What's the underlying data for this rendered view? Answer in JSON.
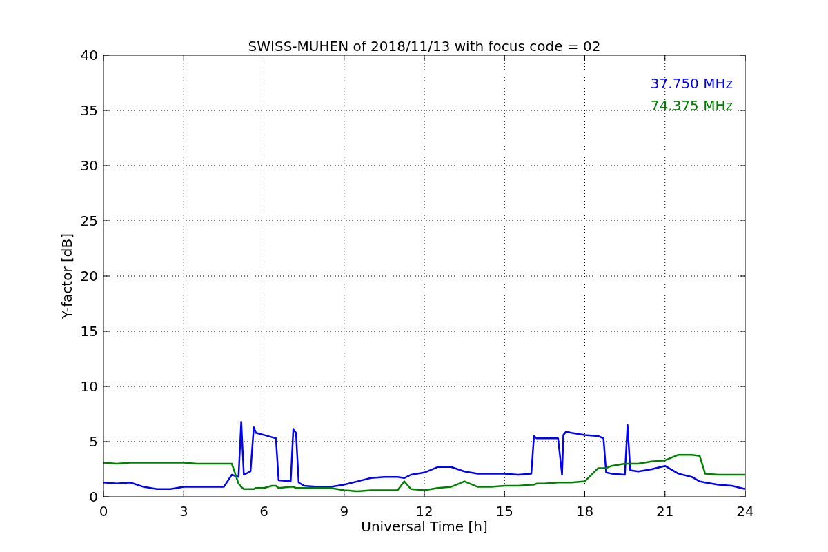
{
  "figure": {
    "chart_data": {
      "type": "line",
      "title": "SWISS-MUHEN of 2018/11/13 with focus code = 02",
      "xlabel": "Universal Time [h]",
      "ylabel": "Y-factor [dB]",
      "x": [
        0,
        0.5,
        1,
        1.5,
        2,
        2.5,
        3,
        3.5,
        4,
        4.5,
        4.8,
        5.05,
        5.15,
        5.25,
        5.5,
        5.62,
        5.7,
        6,
        6.3,
        6.45,
        6.55,
        7,
        7.1,
        7.2,
        7.3,
        7.5,
        8,
        8.5,
        9,
        9.5,
        10,
        10.5,
        11,
        11.25,
        11.5,
        12,
        12.5,
        13,
        13.5,
        14,
        14.5,
        15,
        15.5,
        16,
        16.1,
        16.2,
        16.5,
        17,
        17.15,
        17.2,
        17.3,
        17.5,
        18,
        18.5,
        18.7,
        18.8,
        19,
        19.5,
        19.6,
        19.7,
        20,
        20.5,
        21,
        21.5,
        22,
        22.3,
        22.5,
        23,
        23.5,
        24
      ],
      "series": [
        {
          "name": "37.750 MHz",
          "color": "#0000ff",
          "values": [
            1.3,
            1.2,
            1.3,
            0.9,
            0.7,
            0.7,
            0.9,
            0.9,
            0.9,
            0.9,
            2.0,
            1.8,
            6.8,
            2.0,
            2.3,
            6.3,
            5.8,
            5.6,
            5.4,
            5.3,
            1.5,
            1.4,
            6.1,
            5.8,
            1.3,
            1.0,
            0.9,
            0.9,
            1.1,
            1.4,
            1.7,
            1.8,
            1.8,
            1.7,
            2.0,
            2.2,
            2.7,
            2.7,
            2.3,
            2.1,
            2.1,
            2.1,
            2.0,
            2.1,
            5.5,
            5.3,
            5.3,
            5.3,
            2.0,
            5.6,
            5.9,
            5.8,
            5.6,
            5.5,
            5.3,
            2.2,
            2.1,
            2.0,
            6.5,
            2.4,
            2.3,
            2.5,
            2.8,
            2.1,
            1.8,
            1.4,
            1.3,
            1.1,
            1.0,
            0.7
          ]
        },
        {
          "name": "74.375 MHz",
          "color": "#008000",
          "values": [
            3.1,
            3.0,
            3.1,
            3.1,
            3.1,
            3.1,
            3.1,
            3.0,
            3.0,
            3.0,
            3.0,
            1.2,
            0.9,
            0.7,
            0.7,
            0.7,
            0.8,
            0.8,
            1.0,
            1.0,
            0.8,
            0.9,
            0.9,
            0.8,
            0.8,
            0.8,
            0.8,
            0.8,
            0.6,
            0.5,
            0.6,
            0.6,
            0.6,
            1.4,
            0.7,
            0.6,
            0.8,
            0.9,
            1.4,
            0.9,
            0.9,
            1.0,
            1.0,
            1.1,
            1.1,
            1.2,
            1.2,
            1.3,
            1.3,
            1.3,
            1.3,
            1.3,
            1.4,
            2.6,
            2.6,
            2.6,
            2.8,
            3.0,
            3.0,
            3.0,
            3.0,
            3.2,
            3.3,
            3.8,
            3.8,
            3.7,
            2.1,
            2.0,
            2.0,
            2.0
          ]
        }
      ],
      "grid": true,
      "xlim": [
        0,
        24
      ],
      "ylim": [
        0,
        40
      ],
      "xticks": [
        0,
        3,
        6,
        9,
        12,
        15,
        18,
        21,
        24
      ],
      "yticks": [
        0,
        5,
        10,
        15,
        20,
        25,
        30,
        35,
        40
      ]
    }
  }
}
